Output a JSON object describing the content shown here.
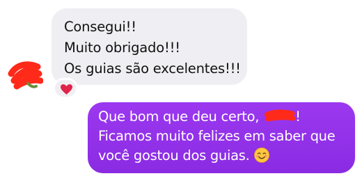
{
  "incoming": {
    "lines": [
      "Consegui!!",
      "Muito obrigado!!!",
      "Os guias são excelentes!!!"
    ],
    "reaction": "heart-emoji"
  },
  "outgoing": {
    "line1_before_redaction": "Que bom que deu certo, ",
    "line1_after_redaction": "!",
    "line2": "Ficamos muito felizes em saber que",
    "line3": "você gostou dos guias.",
    "emoji": "smiling-face-emoji"
  },
  "colors": {
    "incoming_bubble": "#efeff3",
    "outgoing_bubble": "#8a2be2",
    "redaction": "#ff2a1a"
  }
}
